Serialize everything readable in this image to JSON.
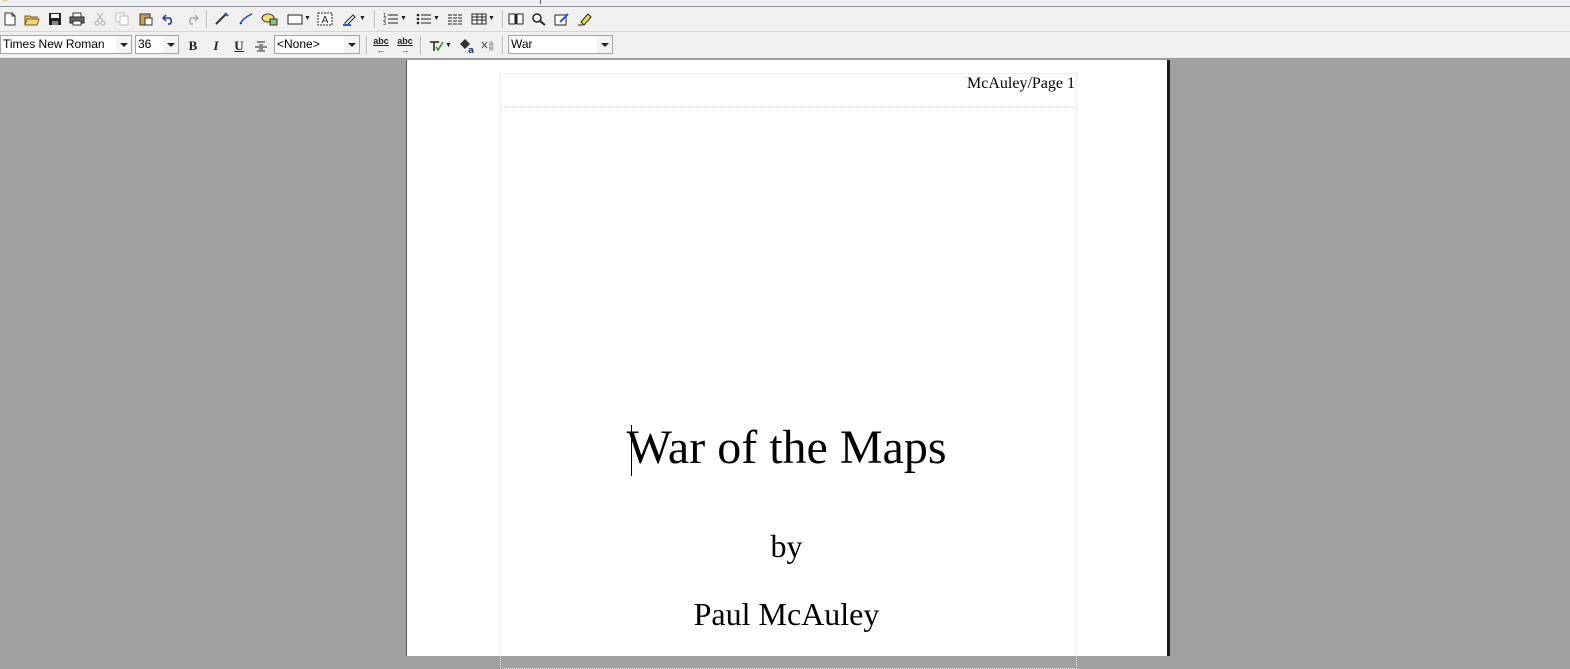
{
  "toolbar": {
    "font_name": "Times New Roman",
    "font_size": "36",
    "bold_label": "B",
    "italic_label": "I",
    "underline_label": "U",
    "style_value": "<None>",
    "abc_label": "abc",
    "lookup_value": "War"
  },
  "icons": [
    "new-document-icon",
    "open-folder-icon",
    "save-icon",
    "print-icon",
    "cut-icon",
    "copy-icon",
    "paste-icon",
    "undo-icon",
    "redo-icon",
    "hyperlink-icon",
    "draw-pen-icon",
    "shapes-icon",
    "rectangle-icon",
    "text-box-icon",
    "highlight-pen-icon",
    "numbered-list-icon",
    "bulleted-list-icon",
    "columns-icon",
    "table-icon",
    "book-icon",
    "zoom-icon",
    "edit-icon",
    "highlighter-icon",
    "strikethrough-icon",
    "spell-check-icon",
    "fill-icon",
    "special-char-icon"
  ],
  "document": {
    "header": "McAuley/Page 1",
    "title": "War of the Maps",
    "byline": "by",
    "author": "Paul McAuley"
  },
  "colors": {
    "workspace": "#a0a0a0",
    "toolbar": "#f0f0f0",
    "page": "#ffffff"
  }
}
